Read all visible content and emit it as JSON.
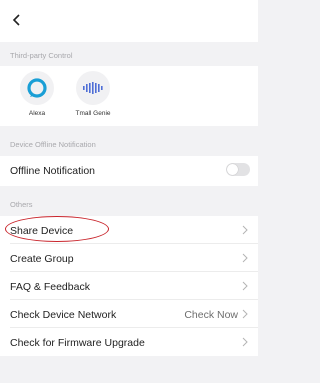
{
  "topbar": {
    "back_icon": "chevron-left-icon"
  },
  "third_party": {
    "header": "Third-party Control",
    "items": [
      {
        "label": "Alexa",
        "icon": "alexa-icon",
        "color": "#1a9fd6"
      },
      {
        "label": "Tmall Genie",
        "icon": "tmall-genie-icon",
        "color": "#4f6fd6"
      }
    ]
  },
  "offline": {
    "header": "Device Offline Notification",
    "row_label": "Offline Notification",
    "toggle_on": false
  },
  "others": {
    "header": "Others",
    "rows": [
      {
        "label": "Share Device",
        "value": ""
      },
      {
        "label": "Create Group",
        "value": ""
      },
      {
        "label": "FAQ & Feedback",
        "value": ""
      },
      {
        "label": "Check Device Network",
        "value": "Check Now"
      },
      {
        "label": "Check for Firmware Upgrade",
        "value": ""
      }
    ]
  },
  "annotation_color": "#c9252c"
}
